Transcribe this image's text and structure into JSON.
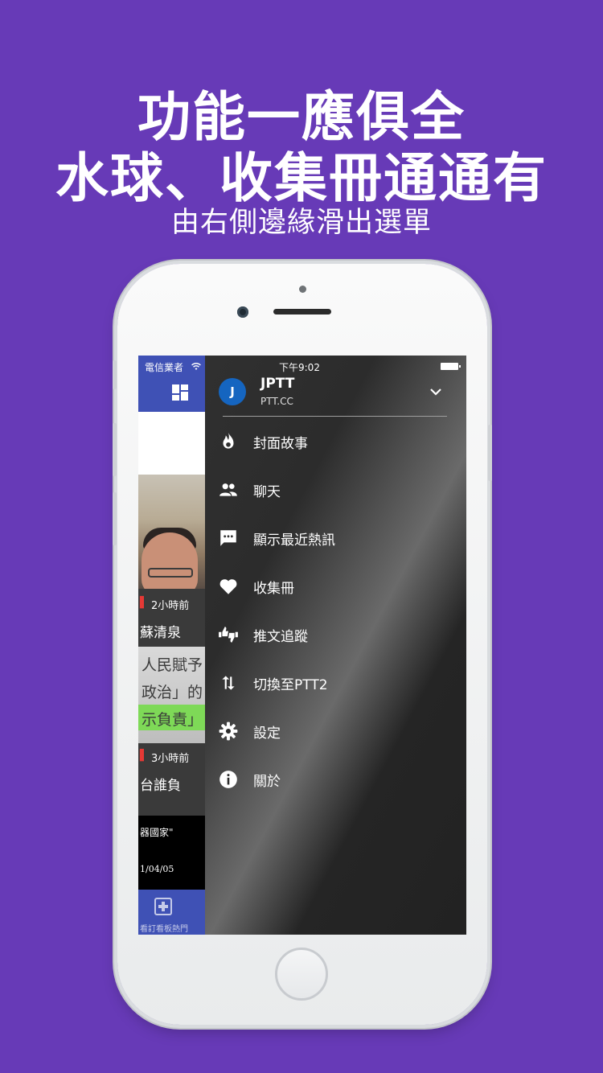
{
  "headline": {
    "line1": "功能一應俱全",
    "line2": "水球、收集冊通通有",
    "line3": "由右側邊緣滑出選單"
  },
  "status_bar": {
    "carrier": "電信業者",
    "time": "下午9:02"
  },
  "account": {
    "initial": "J",
    "name": "JPTT",
    "site": "PTT.CC"
  },
  "menu": [
    {
      "label": "封面故事",
      "icon": "fire-icon"
    },
    {
      "label": "聊天",
      "icon": "people-icon"
    },
    {
      "label": "顯示最近熱訊",
      "icon": "message-icon"
    },
    {
      "label": "收集冊",
      "icon": "heart-icon"
    },
    {
      "label": "推文追蹤",
      "icon": "thumbs-icon"
    },
    {
      "label": "切換至PTT2",
      "icon": "swap-icon"
    },
    {
      "label": "設定",
      "icon": "gear-icon"
    },
    {
      "label": "關於",
      "icon": "info-icon"
    }
  ],
  "background_peek": {
    "item1_time": "2小時前",
    "item1_title": "蘇清泉",
    "paper_line1": "人民賦予",
    "paper_line2": "政治」的",
    "paper_line3": "示負責」",
    "item2_time": "3小時前",
    "item2_title": "台誰負",
    "quote": "器國家\"",
    "date": "1/04/05",
    "bottom_label": "看訂看板熱門"
  },
  "colors": {
    "background": "#673ab7",
    "drawer": "#222222",
    "app_bar": "#3f51b5",
    "avatar": "#1565c0"
  }
}
